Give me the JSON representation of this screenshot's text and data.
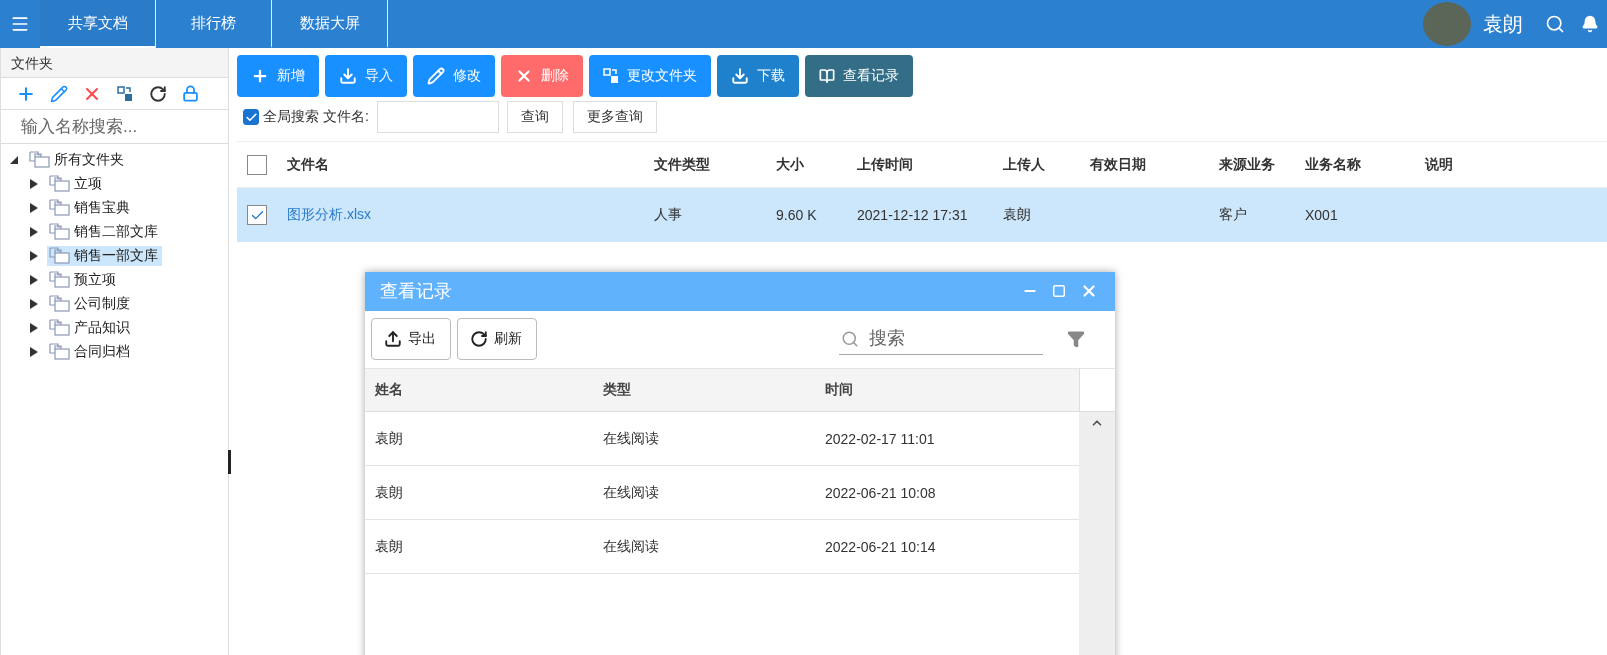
{
  "topbar": {
    "tabs": [
      {
        "label": "共享文档",
        "selected": true
      },
      {
        "label": "排行榜",
        "selected": false
      },
      {
        "label": "数据大屏",
        "selected": false
      }
    ],
    "user": {
      "name": "袁朗"
    }
  },
  "sidebar": {
    "title": "文件夹",
    "search": {
      "placeholder": "输入名称搜索..."
    },
    "tree": [
      {
        "label": "所有文件夹",
        "expanded": true,
        "selected": false,
        "children": [
          {
            "label": "立项",
            "expanded": false,
            "selected": false
          },
          {
            "label": "销售宝典",
            "expanded": false,
            "selected": false
          },
          {
            "label": "销售二部文库",
            "expanded": false,
            "selected": false
          },
          {
            "label": "销售一部文库",
            "expanded": false,
            "selected": true
          },
          {
            "label": "预立项",
            "expanded": false,
            "selected": false
          },
          {
            "label": "公司制度",
            "expanded": false,
            "selected": false
          },
          {
            "label": "产品知识",
            "expanded": false,
            "selected": false
          },
          {
            "label": "合同归档",
            "expanded": false,
            "selected": false
          }
        ]
      }
    ]
  },
  "toolbar": {
    "buttons": [
      {
        "kind": "add",
        "label": "新增"
      },
      {
        "kind": "import",
        "label": "导入"
      },
      {
        "kind": "edit",
        "label": "修改"
      },
      {
        "kind": "delete",
        "label": "删除"
      },
      {
        "kind": "move",
        "label": "更改文件夹"
      },
      {
        "kind": "download",
        "label": "下载"
      },
      {
        "kind": "history",
        "label": "查看记录"
      }
    ]
  },
  "filter": {
    "global_search": {
      "label": "全局搜索",
      "checked": true
    },
    "filename_label": "文件名:",
    "buttons": [
      "查询",
      "更多查询"
    ]
  },
  "table": {
    "all_checked": false,
    "columns": [
      "文件名",
      "文件类型",
      "大小",
      "上传时间",
      "上传人",
      "有效日期",
      "来源业务",
      "业务名称",
      "说明"
    ],
    "rows": [
      {
        "selected": true,
        "cells": [
          "图形分析.xlsx",
          "人事",
          "9.60 K",
          "2021-12-12 17:31",
          "袁朗",
          "",
          "客户",
          "X001",
          ""
        ]
      }
    ]
  },
  "dialog": {
    "title": "查看记录",
    "buttons": [
      {
        "kind": "export",
        "label": "导出"
      },
      {
        "kind": "refresh",
        "label": "刷新"
      }
    ],
    "search": {
      "placeholder": "搜索"
    },
    "columns": [
      "姓名",
      "类型",
      "时间"
    ],
    "rows": [
      [
        "袁朗",
        "在线阅读",
        "2022-02-17 11:01"
      ],
      [
        "袁朗",
        "在线阅读",
        "2022-06-21 10:08"
      ],
      [
        "袁朗",
        "在线阅读",
        "2022-06-21 10:14"
      ]
    ]
  }
}
